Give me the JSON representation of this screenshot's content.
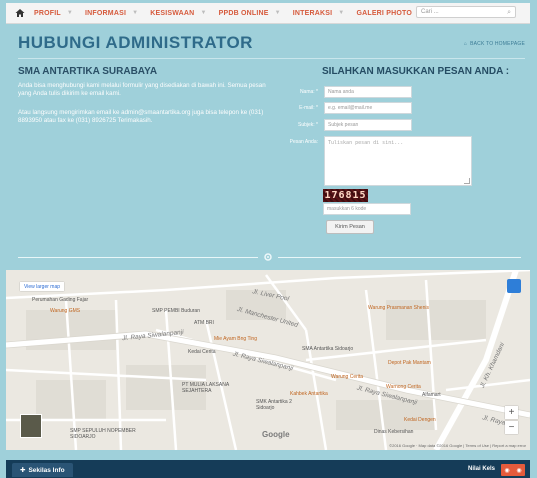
{
  "nav": {
    "items": [
      {
        "label": "PROFIL"
      },
      {
        "label": "INFORMASI"
      },
      {
        "label": "KESISWAAN"
      },
      {
        "label": "PPDB ONLINE"
      },
      {
        "label": "INTERAKSI"
      },
      {
        "label": "GALERI PHOTO"
      }
    ],
    "search_placeholder": "Cari ..."
  },
  "header": {
    "title": "HUBUNGI ADMINISTRATOR",
    "back_label": "BACK TO HOMEPAGE"
  },
  "left": {
    "org_name": "SMA ANTARTIKA SURABAYA",
    "desc1": "Anda bisa menghubungi kami melalui formulir yang disediakan di bawah ini. Semua pesan yang Anda tulis dikirim ke email kami.",
    "desc2": "Atau langsung mengirimkan email ke admin@smaantartika.org juga bisa telepon ke (031) 8893950 atau fax ke (031) 8926725 Terimakasih."
  },
  "form": {
    "title": "SILAHKAN MASUKKAN PESAN ANDA :",
    "name_label": "Nama: *",
    "name_placeholder": "Nama anda",
    "email_label": "E-mail: *",
    "email_placeholder": "e.g. email@mail.me",
    "subject_label": "Subjek: *",
    "subject_placeholder": "Subjek pesan",
    "message_label": "Pesan Anda:",
    "message_placeholder": "Tuliskan pesan di sini...",
    "captcha_text": "176815",
    "captcha_placeholder": "masukkan 6 kode",
    "send_label": "Kirim Pesan"
  },
  "map": {
    "view_larger": "View larger map",
    "labels": {
      "l1": "Perumahan Gading Fajar",
      "l2": "Warung GMS",
      "l3": "SMP PEMBI Buduran",
      "l4": "ATM BRI",
      "l5": "Mie Ayam Bng Ting",
      "l6": "Kedai Cerita",
      "l7": "SMA Antartika Sidoarjo",
      "l8": "Warung Prasmanan Shenis",
      "l9": "Depot Pak Mantam",
      "l10": "Warung Cerita",
      "l11": "Warnong Cerita",
      "l12": "Alfamart",
      "l13": "PT MULIA LAKSANA SEJAHTERA",
      "l14": "Kahbek Antartika",
      "l15": "SMK Antartika 2 Sidoarjo",
      "l16": "Kedai Dengen",
      "l17": "Dinas Kebersihan",
      "l18": "SMP SEPULUH NOPEMBER SIDOARJO"
    },
    "roads": {
      "r1": "Jl. Liver Pool",
      "r2": "Jl. Manchester United",
      "r3": "Jl. Raya Siwalanpanji",
      "r4": "Jl. Raya Siwalanpanji",
      "r5": "Jl. Raya Siwalanpanji",
      "r6": "Jl. Kh. Khamdani",
      "r7": "Jl. Raya Si"
    },
    "google": "Google",
    "footer": "©2016 Google · Map data ©2016 Google | Terms of Use | Report a map error"
  },
  "bottom": {
    "news_label": "Sekilas Info",
    "nilai_label": "Nilai Kels"
  },
  "colors": {
    "background": "#9fd0da",
    "accent": "#d65a3c",
    "title": "#2f6b8a",
    "footer": "#153c58"
  }
}
